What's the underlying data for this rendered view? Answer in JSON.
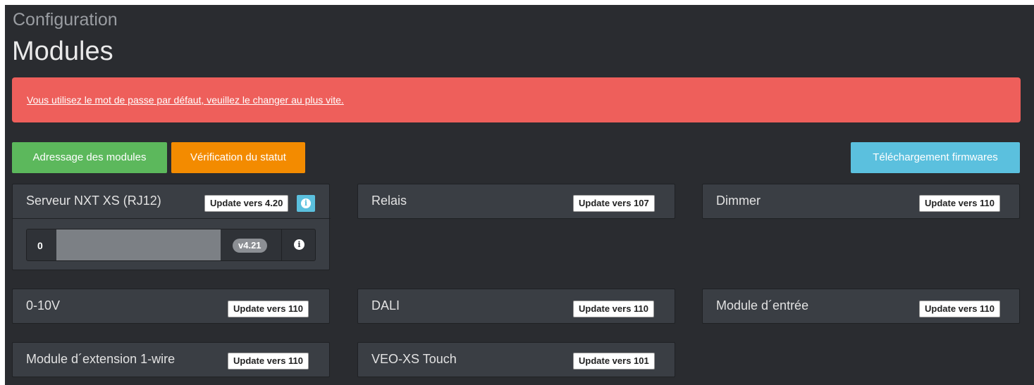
{
  "header": {
    "subtitle": "Configuration",
    "title": "Modules"
  },
  "alert": {
    "text": "Vous utilisez le mot de passe par défaut, veuillez le changer au plus vite."
  },
  "toolbar": {
    "addressing_label": "Adressage des modules",
    "status_label": "Vérification du statut",
    "firmware_label": "Téléchargement firmwares"
  },
  "server": {
    "name": "Serveur NXT XS (RJ12)",
    "update_label": "Update vers 4.20",
    "row": {
      "index": "0",
      "version": "v4.21"
    }
  },
  "modules": [
    {
      "name": "Relais",
      "update_label": "Update vers 107"
    },
    {
      "name": "Dimmer",
      "update_label": "Update vers 110"
    },
    {
      "name": "0-10V",
      "update_label": "Update vers 110"
    },
    {
      "name": "DALI",
      "update_label": "Update vers 110"
    },
    {
      "name": "Module d´entrée",
      "update_label": "Update vers 110"
    },
    {
      "name": "Module d´extension 1-wire",
      "update_label": "Update vers 110"
    },
    {
      "name": "VEO-XS Touch",
      "update_label": "Update vers 101"
    }
  ],
  "colors": {
    "background": "#2a2c30",
    "alert": "#ee5f5b",
    "success": "#5cb85c",
    "warning": "#f38b00",
    "info": "#5bc0de",
    "card": "#3a3e44"
  },
  "icons": {
    "info": "info-circle-icon"
  }
}
